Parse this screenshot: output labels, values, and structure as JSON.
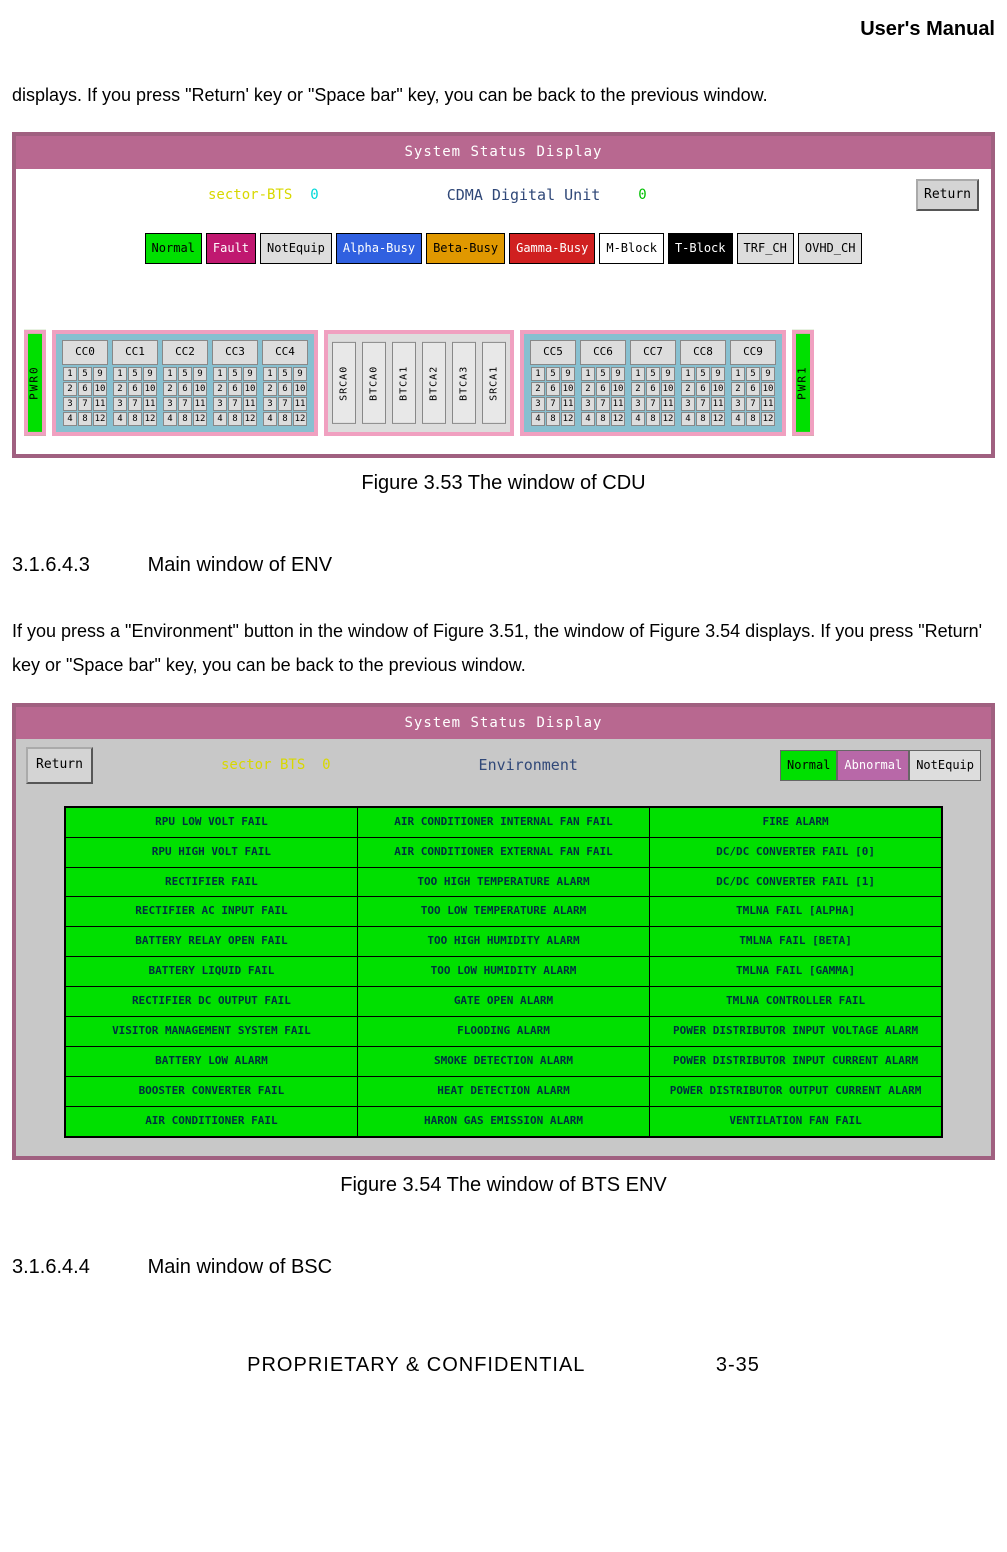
{
  "header": "User's Manual",
  "intro1": "displays. If you press \"Return' key or \"Space bar\" key, you can be back to the previous window.",
  "fig1": {
    "win_title": "System Status Display",
    "sector_label": "sector-BTS",
    "sector_val": "0",
    "unit_title": "CDMA Digital Unit",
    "unit_num": "0",
    "return_btn": "Return",
    "legend": [
      "Normal",
      "Fault",
      "NotEquip",
      "Alpha-Busy",
      "Beta-Busy",
      "Gamma-Busy",
      "M-Block",
      "T-Block",
      "TRF_CH",
      "OVHD_CH"
    ],
    "pwr_left": "PWR0",
    "pwr_right": "PWR1",
    "cc_left": [
      "CC0",
      "CC1",
      "CC2",
      "CC3",
      "CC4"
    ],
    "cc_right": [
      "CC5",
      "CC6",
      "CC7",
      "CC8",
      "CC9"
    ],
    "cells": [
      "1",
      "5",
      "9",
      "2",
      "6",
      "10",
      "3",
      "7",
      "11",
      "4",
      "8",
      "12"
    ],
    "btca": [
      "SRCA0",
      "BTCA0",
      "BTCA1",
      "BTCA2",
      "BTCA3",
      "SRCA1"
    ],
    "caption": "Figure 3.53 The window of CDU"
  },
  "sec1": {
    "num": "3.1.6.4.3",
    "title": "Main window of ENV"
  },
  "para2": "If you press a \"Environment\" button in the window of Figure 3.51, the window of Figure 3.54 displays. If you press \"Return' key or \"Space bar\" key, you can be back to the previous window.",
  "fig2": {
    "win_title": "System Status Display",
    "return_btn": "Return",
    "sector": "sector BTS  0",
    "title": "Environment",
    "legend": [
      "Normal",
      "Abnormal",
      "NotEquip"
    ],
    "rows": [
      [
        "RPU LOW VOLT FAIL",
        "AIR CONDITIONER INTERNAL FAN FAIL",
        "FIRE ALARM"
      ],
      [
        "RPU HIGH VOLT FAIL",
        "AIR CONDITIONER EXTERNAL FAN FAIL",
        "DC/DC CONVERTER FAIL [0]"
      ],
      [
        "RECTIFIER FAIL",
        "TOO HIGH TEMPERATURE ALARM",
        "DC/DC CONVERTER FAIL [1]"
      ],
      [
        "RECTIFIER AC INPUT FAIL",
        "TOO LOW TEMPERATURE ALARM",
        "TMLNA FAIL [ALPHA]"
      ],
      [
        "BATTERY RELAY OPEN FAIL",
        "TOO HIGH HUMIDITY ALARM",
        "TMLNA FAIL   [BETA]"
      ],
      [
        "BATTERY LIQUID FAIL",
        "TOO LOW HUMIDITY ALARM",
        "TMLNA FAIL [GAMMA]"
      ],
      [
        "RECTIFIER DC OUTPUT FAIL",
        "GATE OPEN ALARM",
        "TMLNA CONTROLLER FAIL"
      ],
      [
        "VISITOR MANAGEMENT SYSTEM FAIL",
        "FLOODING ALARM",
        "POWER DISTRIBUTOR INPUT VOLTAGE ALARM"
      ],
      [
        "BATTERY LOW ALARM",
        "SMOKE DETECTION ALARM",
        "POWER DISTRIBUTOR   INPUT   CURRENT ALARM"
      ],
      [
        "BOOSTER CONVERTER FAIL",
        "HEAT   DETECTION ALARM",
        "POWER DISTRIBUTOR OUTPUT CURRENT ALARM"
      ],
      [
        "AIR CONDITIONER FAIL",
        "HARON GAS EMISSION ALARM",
        "VENTILATION FAN FAIL"
      ]
    ],
    "caption": "Figure 3.54 The window of BTS ENV"
  },
  "sec2": {
    "num": "3.1.6.4.4",
    "title": "Main window of BSC"
  },
  "footer": "PROPRIETARY & CONFIDENTIAL                    3-35"
}
